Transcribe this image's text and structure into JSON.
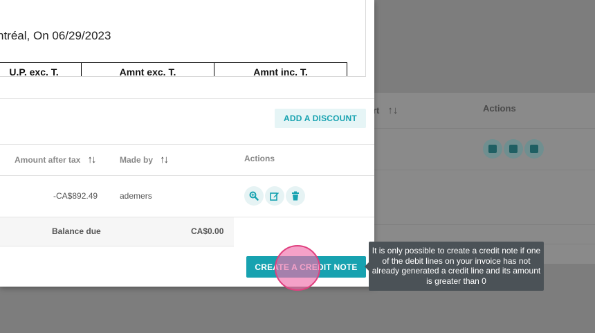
{
  "background": {
    "sort_header_partial": "rt",
    "actions_label": "Actions"
  },
  "document": {
    "date_line": "ntréal, On 06/29/2023",
    "columns": [
      "U.P. exc. T.",
      "Amnt exc. T.",
      "Amnt inc. T."
    ]
  },
  "discount_button": "ADD A DISCOUNT",
  "table": {
    "headers": {
      "amount_after_tax": "Amount after tax",
      "made_by": "Made by",
      "actions": "Actions"
    },
    "rows": [
      {
        "amount_after_tax": "-CA$892.49",
        "made_by": "ademers"
      }
    ],
    "balance_due_label": "Balance due",
    "balance_due_value": "CA$0.00"
  },
  "credit_note_button": "CREATE A CREDIT NOTE",
  "tooltip": "It is only possible to create a credit note if one of the debit lines on your invoice has not already generated a credit line and its amount is greater than 0",
  "colors": {
    "accent": "#17a2b0",
    "accent_light": "#e6f5f6",
    "tooltip_bg": "#4b5257",
    "overlay": "#7d7d7d"
  }
}
